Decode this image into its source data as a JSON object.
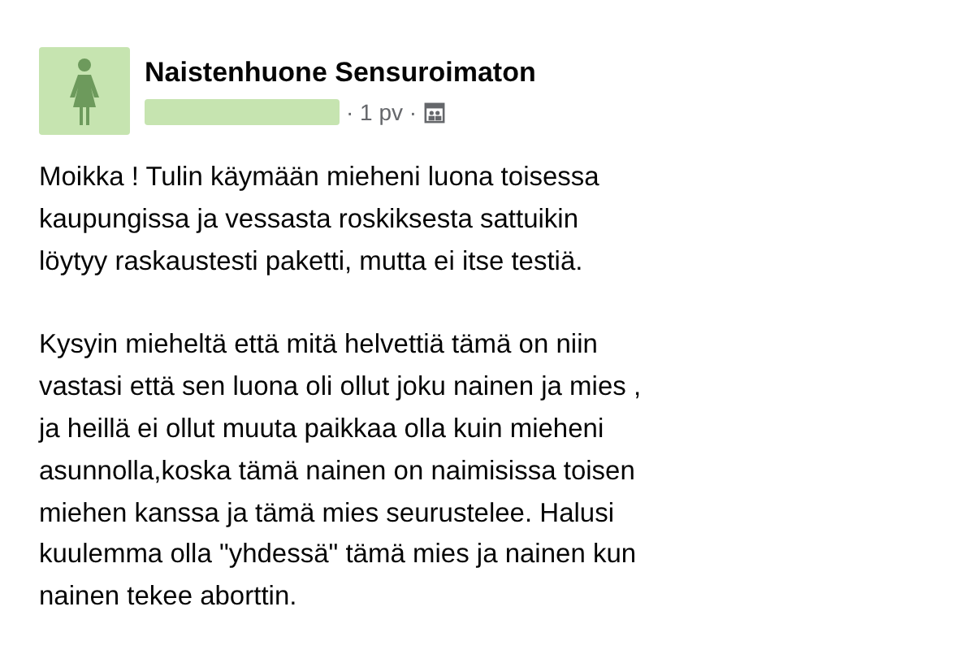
{
  "post": {
    "group_name": "Naistenhuone Sensuroimaton",
    "time": "· 1 pv ·",
    "paragraphs": [
      "Moikka ! Tulin käymään mieheni luona toisessa\nkaupungissa ja vessasta roskiksesta sattuikin\nlöytyy raskaustesti paketti, mutta ei itse testiä.",
      "Kysyin mieheltä että mitä helvettiä tämä on niin\nvastasi että sen luona oli ollut joku nainen ja mies ,\nja heillä ei ollut muuta paikkaa olla kuin mieheni\nasunnolla,koska tämä nainen on naimisissa toisen\nmiehen kanssa ja tämä mies seurustelee. Halusi\nkuulemma olla \"yhdessä\" tämä mies ja nainen kun\nnainen tekee aborttin."
    ]
  }
}
